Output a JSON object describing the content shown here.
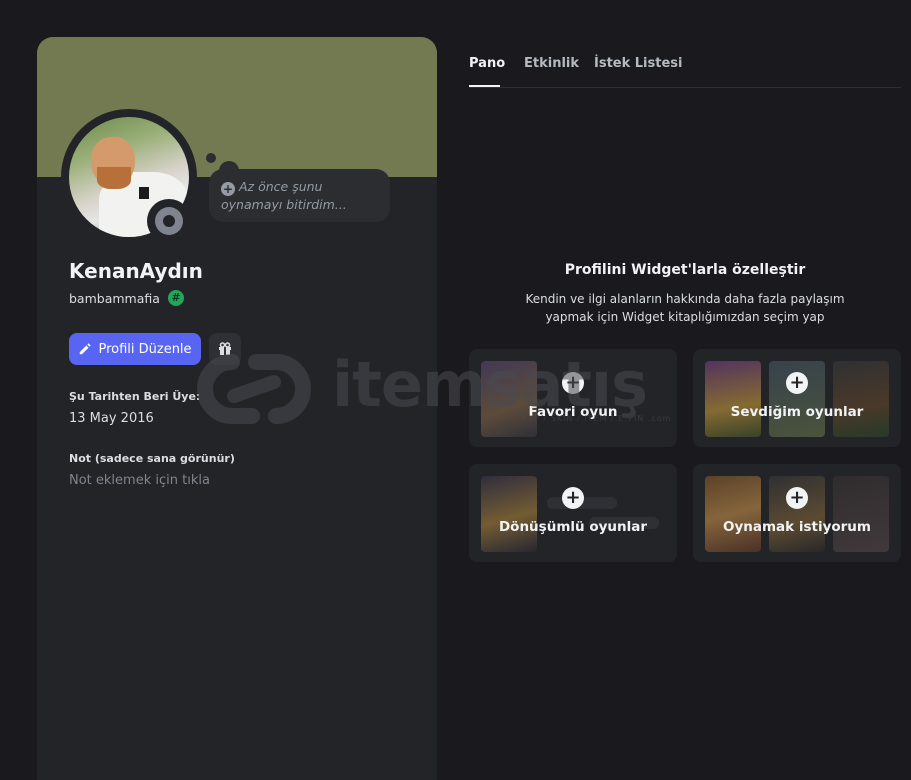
{
  "profile": {
    "display_name": "KenanAydın",
    "username": "bambammafia",
    "username_badge": "#",
    "activity_bubble": "Az önce şunu oynamayı bitirdim...",
    "edit_button": "Profili Düzenle",
    "member_since_label": "Şu Tarihten Beri Üye:",
    "member_since_value": "13 May 2016",
    "note_label": "Not (sadece sana görünür)",
    "note_placeholder": "Not eklemek için tıkla"
  },
  "tabs": [
    {
      "label": "Pano",
      "active": true
    },
    {
      "label": "Etkinlik",
      "active": false
    },
    {
      "label": "İstek Listesi",
      "active": false
    }
  ],
  "promo": {
    "title": "Profilini Widget'larla özelleştir",
    "description": "Kendin ve ilgi alanların hakkında daha fazla paylaşım yapmak için Widget kitaplığımızdan seçim yap"
  },
  "widgets": [
    {
      "label": "Favori oyun",
      "icon": "plus-icon"
    },
    {
      "label": "Sevdiğim oyunlar",
      "icon": "plus-icon"
    },
    {
      "label": "Dönüşümlü oyunlar",
      "icon": "plus-icon"
    },
    {
      "label": "Oynamak istiyorum",
      "icon": "plus-icon"
    }
  ],
  "watermark": {
    "text": "itemsatış",
    "subtext": "ESP / SKIN / ITEM / E-PIN .com"
  },
  "colors": {
    "banner": "#737a51",
    "accent": "#5865f2",
    "badge": "#23a55a",
    "status_idle": "#80848e"
  }
}
